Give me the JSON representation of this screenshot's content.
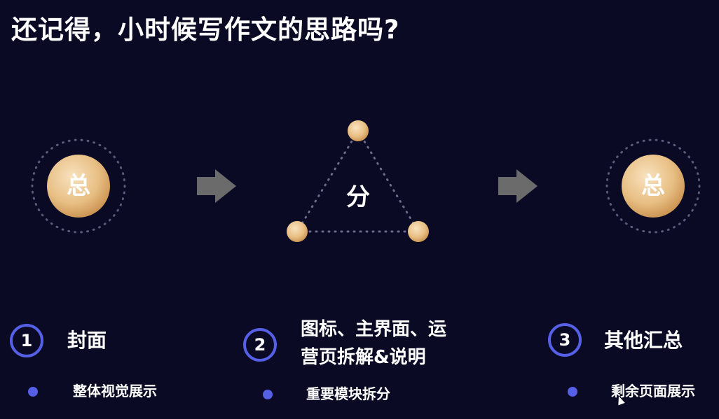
{
  "title": "还记得，小时候写作文的思路吗?",
  "diagram": {
    "left_node": "总",
    "middle_node": "分",
    "right_node": "总"
  },
  "steps": [
    {
      "number": "1",
      "title": "封面",
      "subtitle": "整体视觉展示"
    },
    {
      "number": "2",
      "title_line1": "图标、主界面、运",
      "title_line2": "营页拆解&说明",
      "subtitle": "重要模块拆分"
    },
    {
      "number": "3",
      "title": "其他汇总",
      "subtitle": "剩余页面展示"
    }
  ],
  "colors": {
    "background": "#0b0a24",
    "accent": "#5560e6",
    "gold": "#e8bf84"
  }
}
